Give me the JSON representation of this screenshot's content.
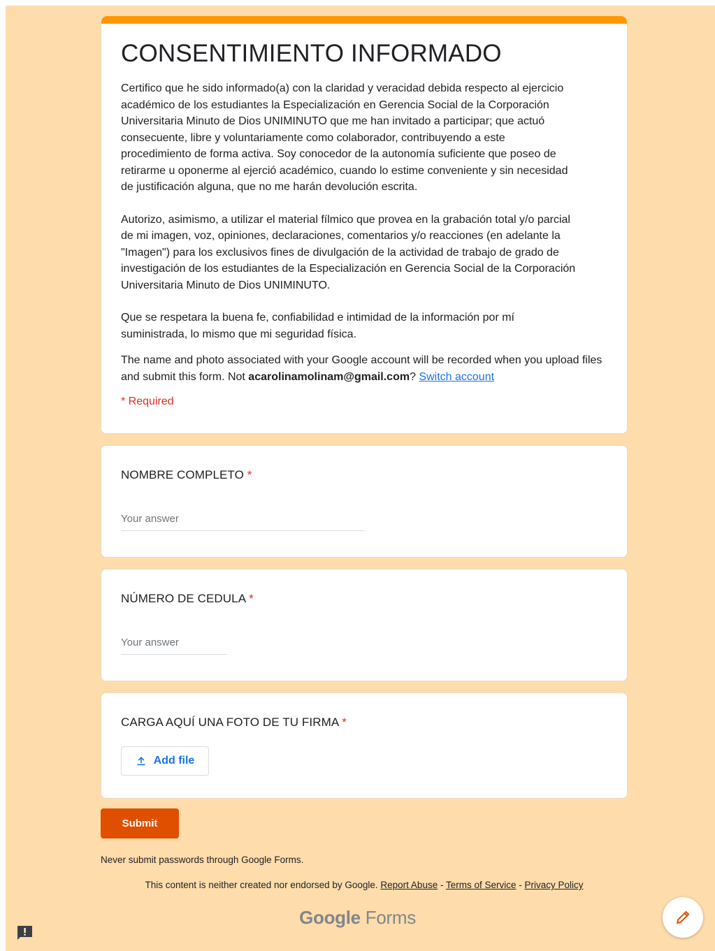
{
  "form": {
    "title": "CONSENTIMIENTO INFORMADO",
    "description": [
      "Certifico que he sido informado(a) con la claridad y veracidad debida respecto al ejercicio\nacadémico de los estudiantes la Especialización en Gerencia Social de la Corporación\nUniversitaria Minuto de Dios UNIMINUTO que me han invitado a participar; que actuó\nconsecuente, libre y voluntariamente como colaborador, contribuyendo a este\nprocedimiento de forma activa. Soy conocedor de la autonomía suficiente que poseo de\nretirarme u oponerme al ejerció académico, cuando lo estime conveniente y sin necesidad\nde justificación alguna, que no me harán devolución escrita.",
      "Autorizo, asimismo, a utilizar el material fílmico que provea en la grabación total y/o parcial\nde mi imagen, voz, opiniones, declaraciones, comentarios y/o reacciones (en adelante la\n\"Imagen\") para los exclusivos fines de divulgación de la actividad de trabajo de grado de\ninvestigación de los estudiantes de la Especialización en Gerencia Social de la Corporación\nUniversitaria Minuto de Dios UNIMINUTO.",
      "Que se respetara la buena fe, confiabilidad e intimidad de la información por mí\nsuministrada, lo mismo que mi seguridad física."
    ],
    "account_note_prefix": "The name and photo associated with your Google account will be recorded when you upload files and submit this form. Not ",
    "account_email": "acarolinamolinam@gmail.com",
    "account_note_suffix": "? ",
    "switch_account": "Switch account",
    "required_note": "* Required"
  },
  "questions": [
    {
      "title": "NOMBRE COMPLETO",
      "required_mark": "*",
      "placeholder": "Your answer"
    },
    {
      "title": "NÚMERO DE CEDULA",
      "required_mark": "*",
      "placeholder": "Your answer"
    },
    {
      "title": "CARGA AQUÍ UNA FOTO DE TU FIRMA",
      "required_mark": "*",
      "button_label": "Add file"
    }
  ],
  "submit_label": "Submit",
  "never_note": "Never submit passwords through Google Forms.",
  "footer": {
    "disclaimer": "This content is neither created nor endorsed by Google. ",
    "report_abuse": "Report Abuse",
    "sep": " - ",
    "terms": "Terms of Service",
    "privacy": "Privacy Policy"
  },
  "brand": {
    "google": "Google",
    "forms": " Forms"
  },
  "icons": {
    "upload": "upload-icon",
    "feedback": "feedback-icon",
    "edit": "edit-pencil-icon"
  },
  "colors": {
    "background": "#fedcab",
    "accent": "#ff9800",
    "submit": "#e04e00",
    "required": "#d93025",
    "link": "#1a73e8"
  }
}
